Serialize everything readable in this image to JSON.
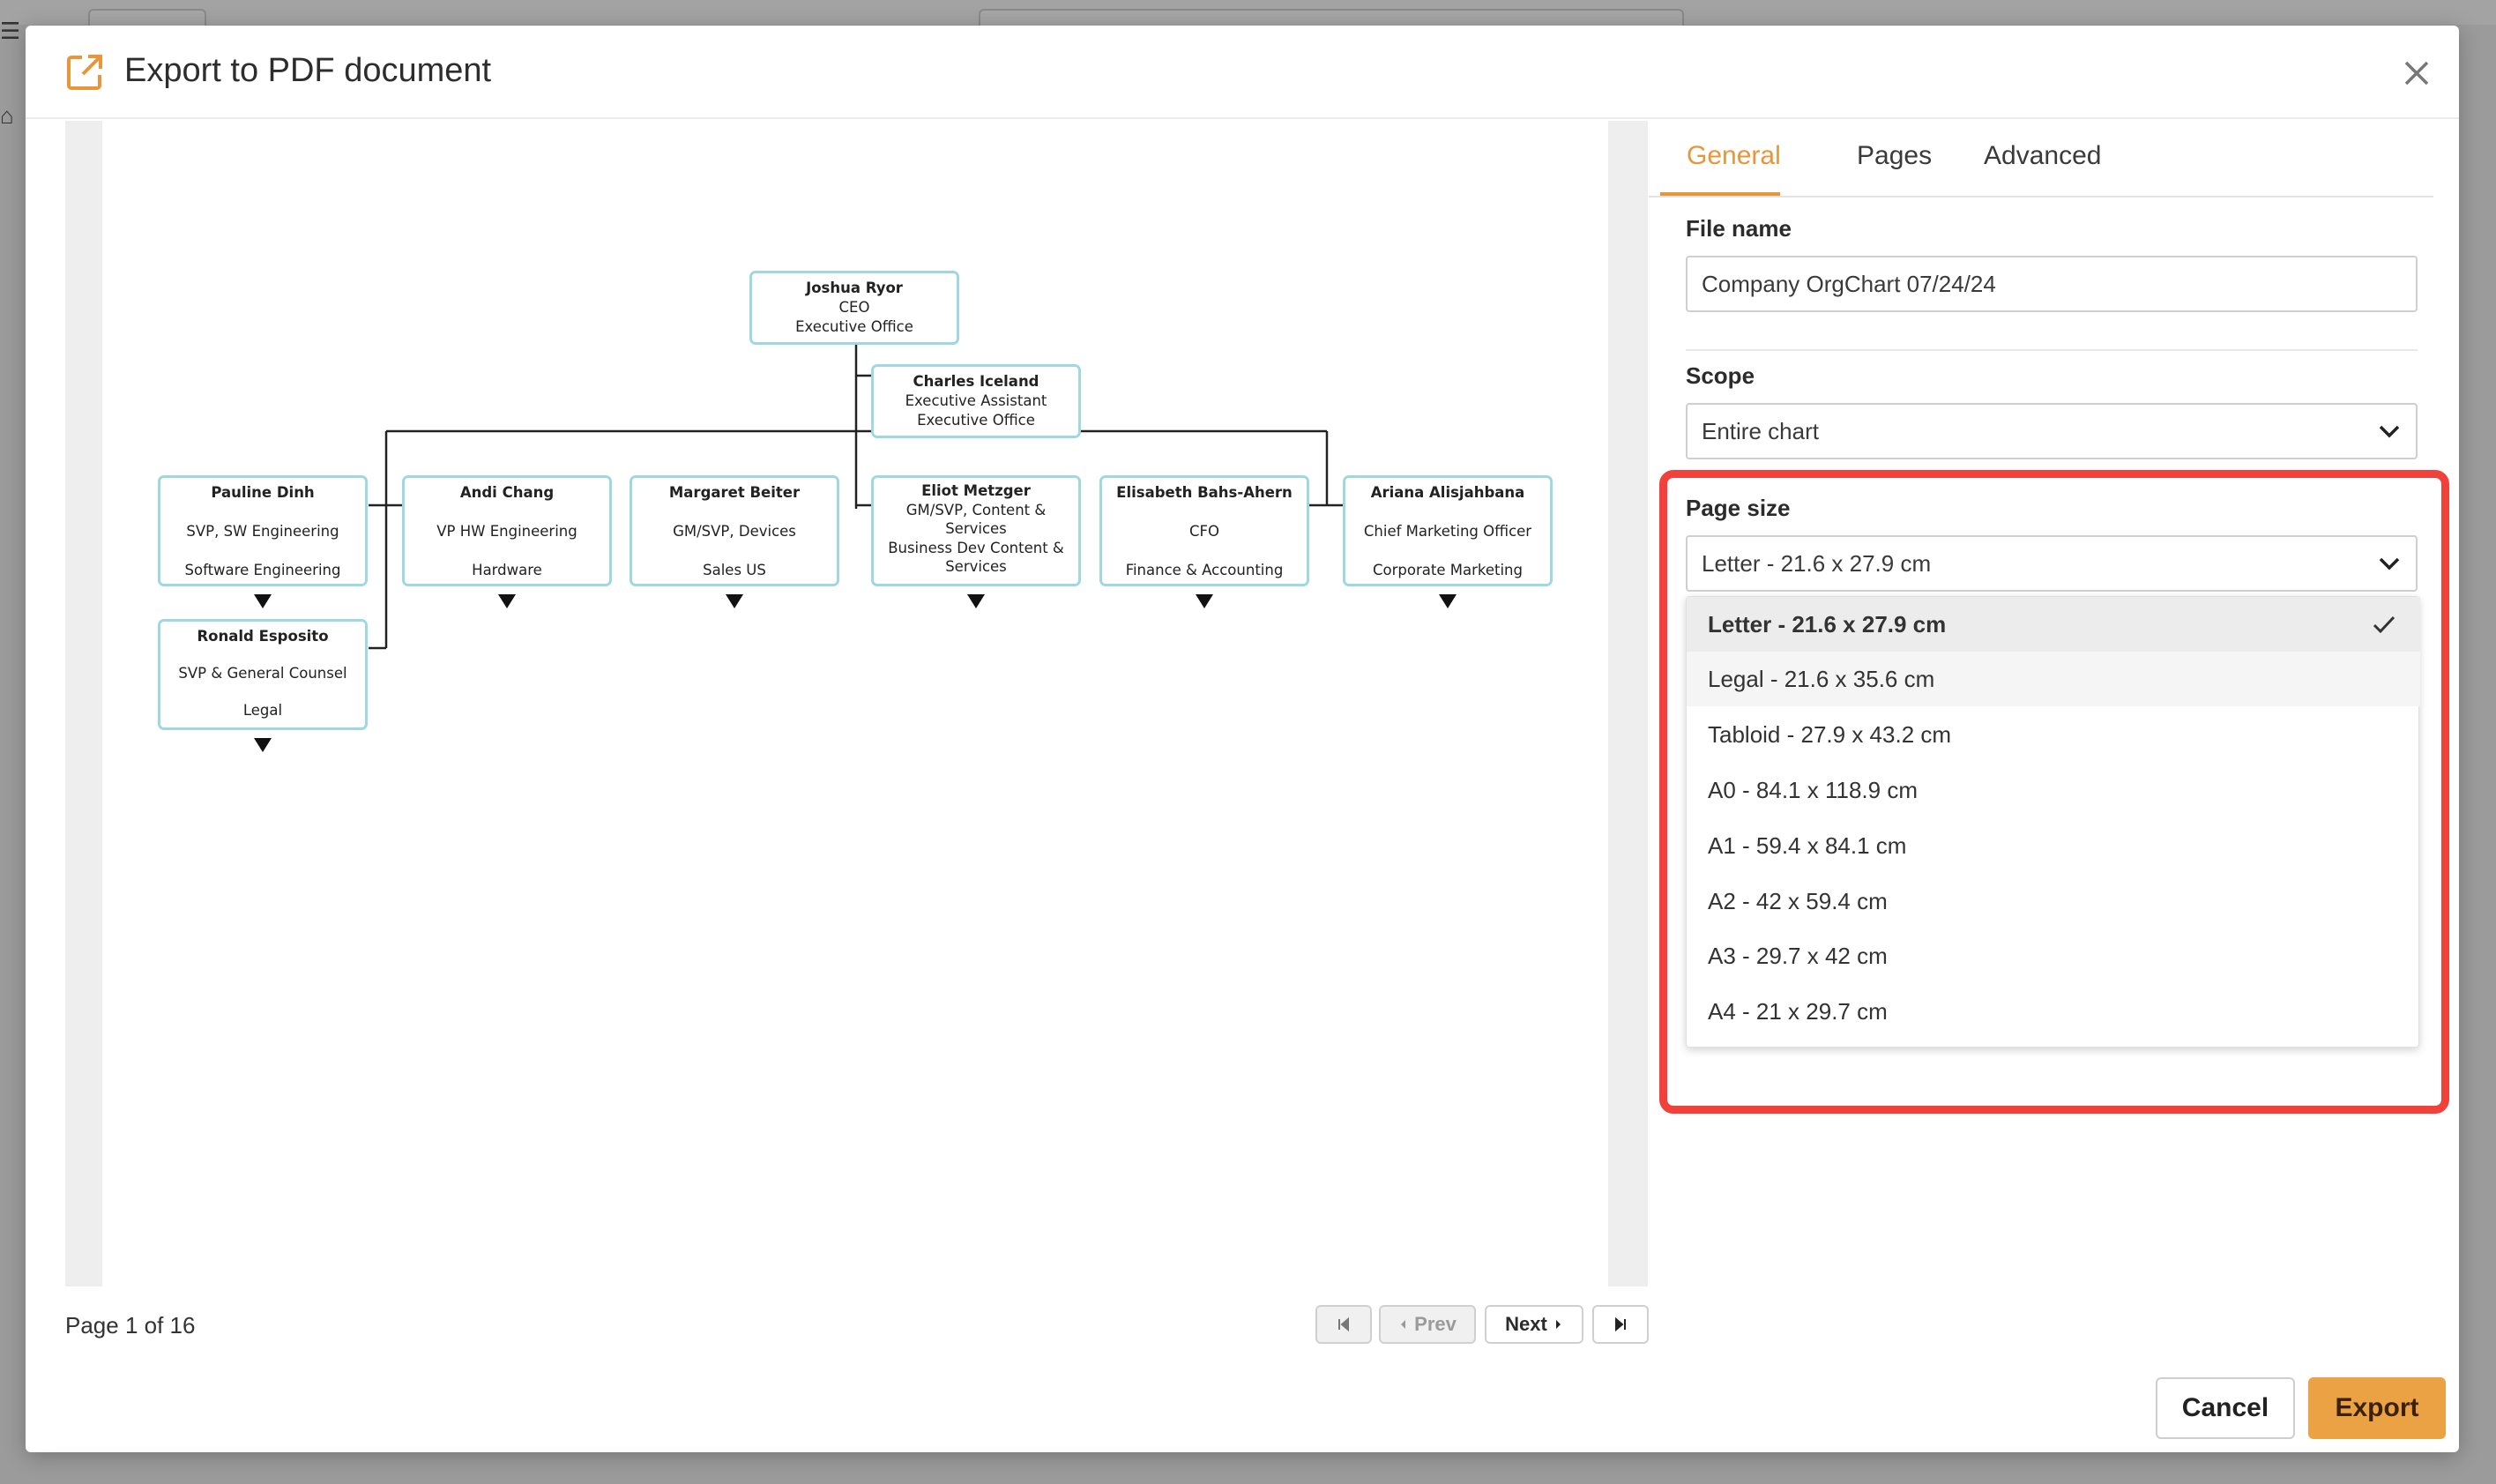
{
  "dialog": {
    "title": "Export to PDF document",
    "icon": "external-link-icon",
    "accent": "#e8963a"
  },
  "org_chart": {
    "nodes": [
      {
        "id": "ceo",
        "name": "Joshua Ryor",
        "lines": [
          "CEO",
          "Executive Office"
        ]
      },
      {
        "id": "assistant",
        "name": "Charles Iceland",
        "lines": [
          "Executive Assistant",
          "Executive Office"
        ]
      },
      {
        "id": "pauline",
        "name": "Pauline Dinh",
        "lines": [
          "SVP, SW Engineering",
          "Software Engineering"
        ]
      },
      {
        "id": "andi",
        "name": "Andi Chang",
        "lines": [
          "VP HW Engineering",
          "Hardware"
        ]
      },
      {
        "id": "margaret",
        "name": "Margaret Beiter",
        "lines": [
          "GM/SVP, Devices",
          "Sales US"
        ]
      },
      {
        "id": "eliot",
        "name": "Eliot Metzger",
        "lines": [
          "GM/SVP, Content &",
          "Services",
          "Business Dev Content &",
          "Services"
        ]
      },
      {
        "id": "elisabeth",
        "name": "Elisabeth Bahs-Ahern",
        "lines": [
          "CFO",
          "Finance & Accounting"
        ]
      },
      {
        "id": "ariana",
        "name": "Ariana Alisjahbana",
        "lines": [
          "Chief Marketing Officer",
          "Corporate Marketing"
        ]
      },
      {
        "id": "ronald",
        "name": "Ronald Esposito",
        "lines": [
          "SVP & General Counsel",
          "Legal"
        ]
      }
    ]
  },
  "pagination": {
    "page_info": "Page 1 of 16",
    "prev_label": "Prev",
    "next_label": "Next"
  },
  "tabs": [
    {
      "label": "General",
      "active": true
    },
    {
      "label": "Pages",
      "active": false
    },
    {
      "label": "Advanced",
      "active": false
    }
  ],
  "form": {
    "file_name_label": "File name",
    "file_name_value": "Company OrgChart 07/24/24",
    "scope_label": "Scope",
    "scope_value": "Entire chart",
    "page_size_label": "Page size",
    "page_size_value": "Letter - 21.6 x 27.9 cm",
    "page_size_options": [
      "Letter - 21.6 x 27.9 cm",
      "Legal - 21.6 x 35.6 cm",
      "Tabloid - 27.9 x 43.2 cm",
      "A0 - 84.1 x 118.9 cm",
      "A1 - 59.4 x 84.1 cm",
      "A2 - 42 x 59.4 cm",
      "A3 - 29.7 x 42 cm",
      "A4 - 21 x 29.7 cm"
    ],
    "highlight_color": "#f2413a"
  },
  "footer": {
    "cancel_label": "Cancel",
    "export_label": "Export",
    "export_color": "#eba245"
  }
}
